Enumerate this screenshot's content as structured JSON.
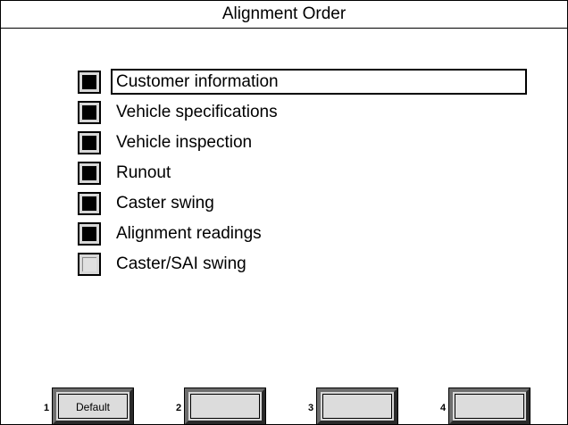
{
  "window": {
    "title": "Alignment Order"
  },
  "options": [
    {
      "label": "Customer information",
      "checked": true,
      "focused": true
    },
    {
      "label": "Vehicle specifications",
      "checked": true,
      "focused": false
    },
    {
      "label": "Vehicle inspection",
      "checked": true,
      "focused": false
    },
    {
      "label": "Runout",
      "checked": true,
      "focused": false
    },
    {
      "label": "Caster swing",
      "checked": true,
      "focused": false
    },
    {
      "label": "Alignment readings",
      "checked": true,
      "focused": false
    },
    {
      "label": "Caster/SAI swing",
      "checked": false,
      "focused": false
    }
  ],
  "function_keys": [
    {
      "number": "1",
      "label": "Default"
    },
    {
      "number": "2",
      "label": ""
    },
    {
      "number": "3",
      "label": ""
    },
    {
      "number": "4",
      "label": ""
    }
  ],
  "colors": {
    "checked_fill": "#000000",
    "unchecked_fill": "#e0e0e0",
    "button_face": "#dcdcdc"
  }
}
